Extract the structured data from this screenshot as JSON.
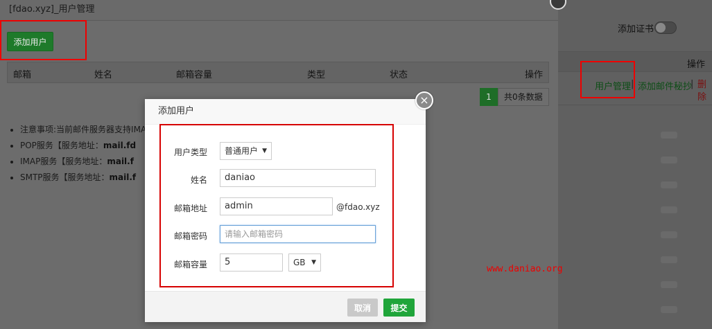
{
  "background_panel": {
    "cert_label": "添加证书",
    "op_header": "操作",
    "row_link_user_manage": "用户管理",
    "row_sep": "|",
    "row_link_add_secret": "添加邮件秘抄",
    "row_link_delete": "删除"
  },
  "user_manage": {
    "title": "[fdao.xyz]_用户管理",
    "add_user_button": "添加用户",
    "columns": [
      "邮箱",
      "姓名",
      "邮箱容量",
      "类型",
      "状态",
      "操作"
    ],
    "pager": {
      "page": "1",
      "info": "共0条数据"
    },
    "notes": [
      {
        "text": "注意事项:当前邮件服务器支持IMAP",
        "bold": ""
      },
      {
        "text": "POP服务【服务地址：",
        "bold": "mail.fd"
      },
      {
        "text": "IMAP服务【服务地址：",
        "bold": "mail.f"
      },
      {
        "text": "SMTP服务【服务地址：",
        "bold": "mail.f"
      }
    ]
  },
  "dialog": {
    "title": "添加用户",
    "close_glyph": "×",
    "user_type_label": "用户类型",
    "user_type_value": "普通用户",
    "name_label": "姓名",
    "name_value": "daniao",
    "email_label": "邮箱地址",
    "email_value": "admin",
    "email_suffix": "@fdao.xyz",
    "password_label": "邮箱密码",
    "password_placeholder": "请输入邮箱密码",
    "capacity_label": "邮箱容量",
    "capacity_value": "5",
    "capacity_unit": "GB",
    "cancel_label": "取消",
    "submit_label": "提交"
  },
  "watermark": "www.daniao.org",
  "colors": {
    "primary_green": "#20a53a",
    "highlight_red": "#e00000"
  }
}
